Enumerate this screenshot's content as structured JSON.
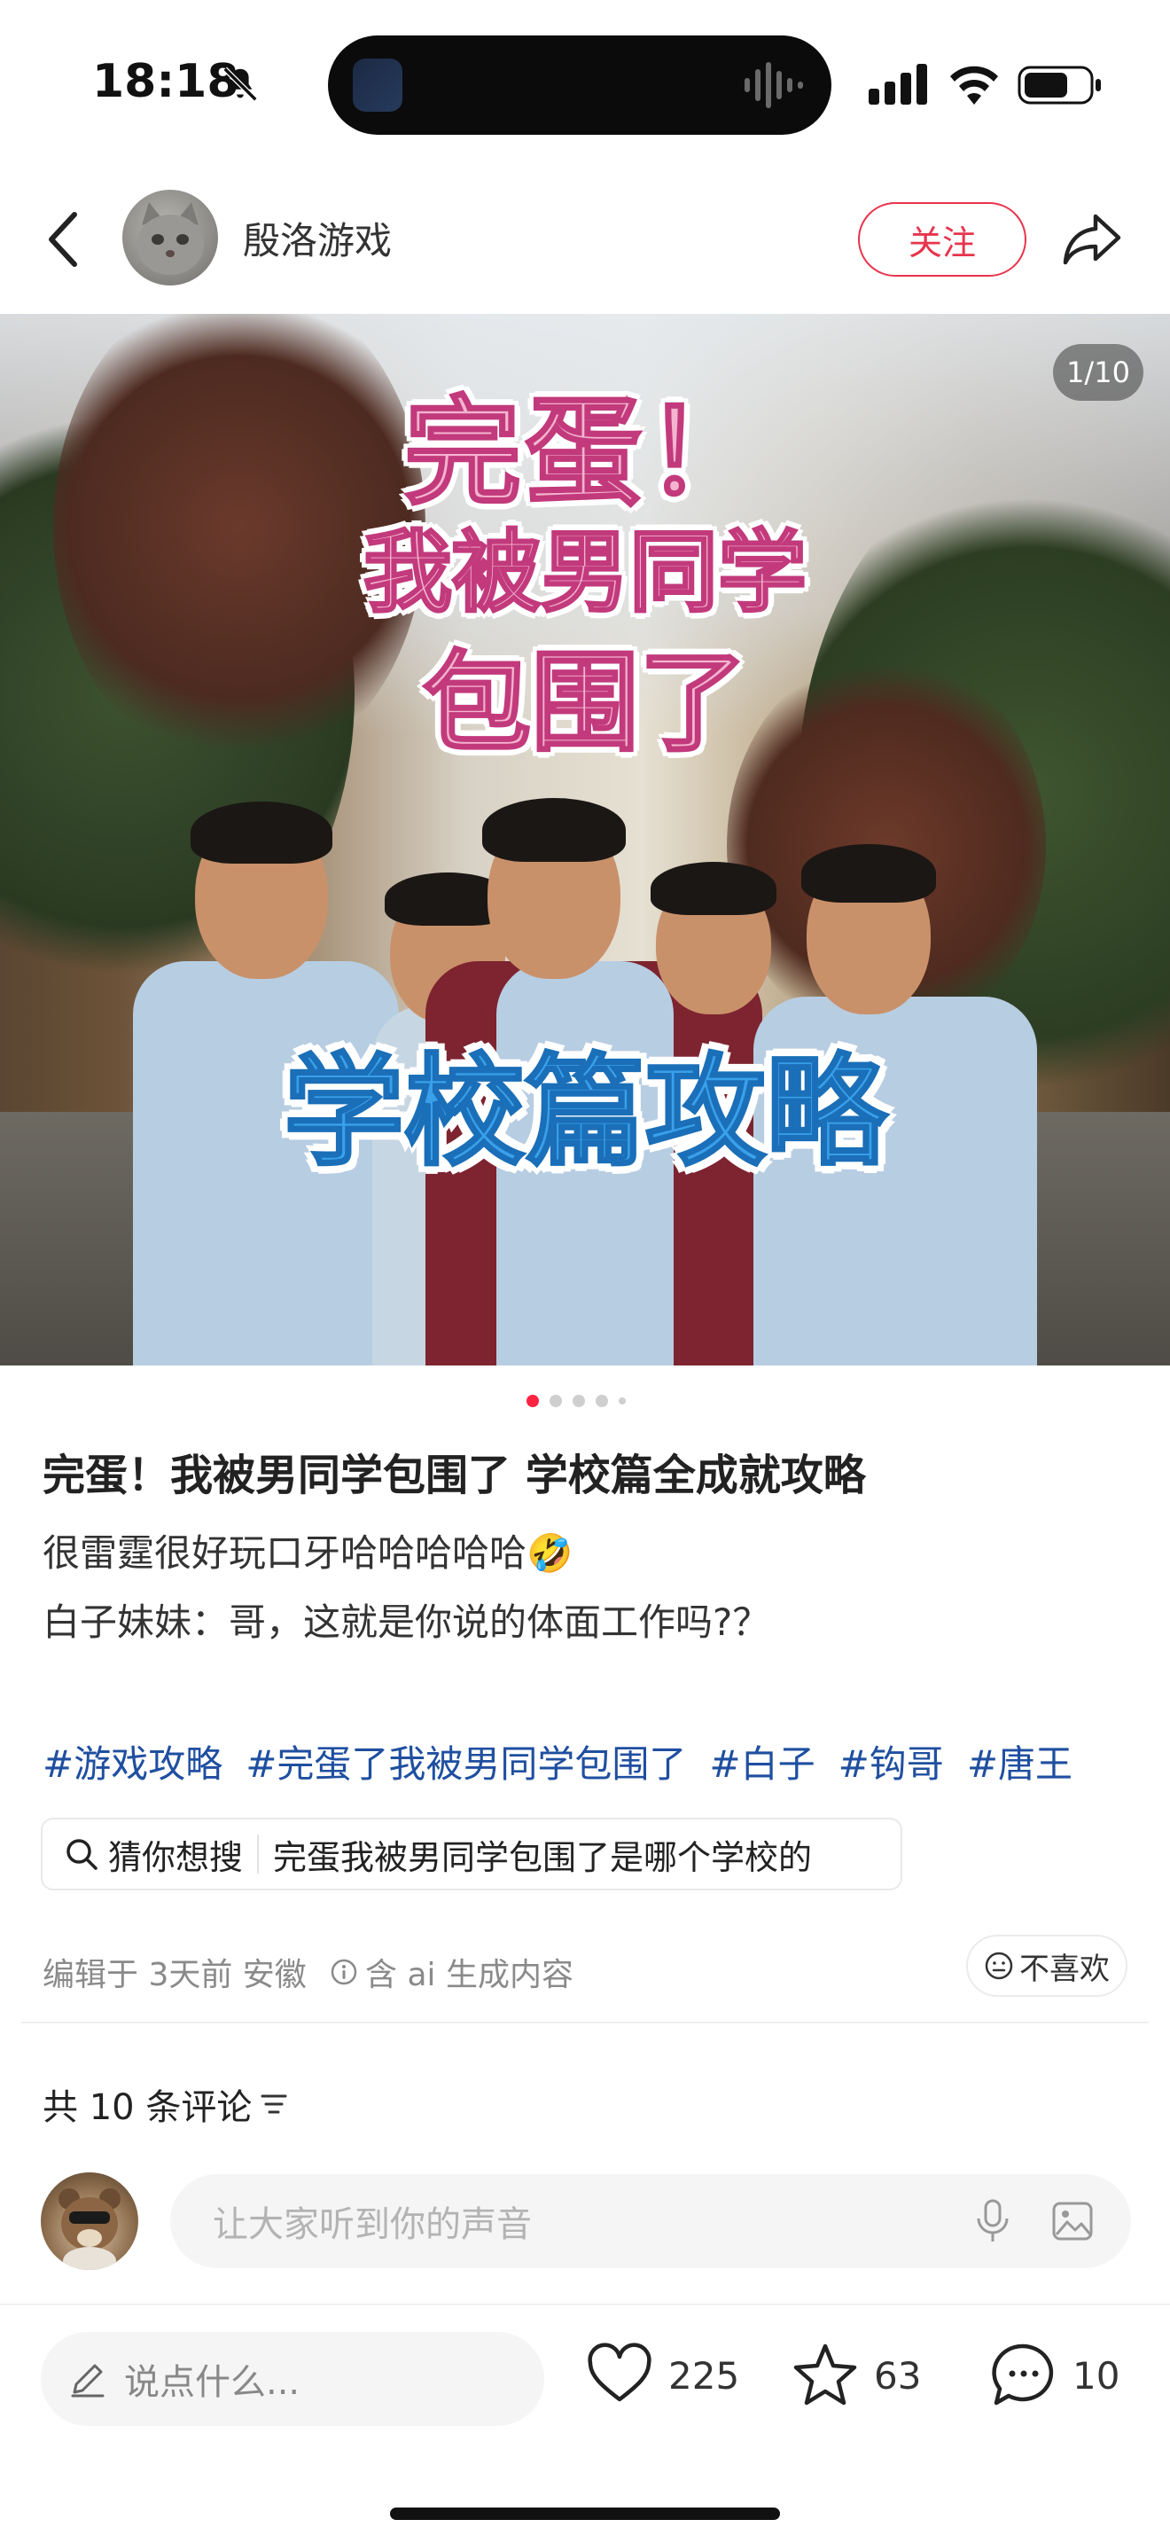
{
  "status_bar": {
    "time": "18:18"
  },
  "header": {
    "author_name": "殷洛游戏",
    "follow_label": "关注"
  },
  "hero": {
    "counter": "1/10",
    "title_line1": "完蛋！",
    "title_line2": "我被男同学",
    "title_line3": "包围了",
    "subtitle": "学校篇攻略"
  },
  "pager": {
    "current": 1
  },
  "post": {
    "title": "完蛋！我被男同学包围了 学校篇全成就攻略",
    "line1": "很雷霆很好玩口牙哈哈哈哈哈🤣",
    "line2": "白子妹妹：哥，这就是你说的体面工作吗?？",
    "hashtags": [
      "#游戏攻略",
      "#完蛋了我被男同学包围了",
      "#白子",
      "#钩哥",
      "#唐王"
    ],
    "suggest_label": "猜你想搜",
    "suggest_query": "完蛋我被男同学包围了是哪个学校的",
    "meta": "编辑于 3天前 安徽",
    "ai_note": "含 ai 生成内容",
    "dislike_label": "不喜欢"
  },
  "comments": {
    "header": "共 10 条评论",
    "input_placeholder": "让大家听到你的声音"
  },
  "bottom_bar": {
    "say_placeholder": "说点什么...",
    "likes": "225",
    "collects": "63",
    "comments": "10"
  },
  "colors": {
    "accent": "#ff2442",
    "follow": "#e8344d",
    "hashtag": "#1f4fa0"
  }
}
